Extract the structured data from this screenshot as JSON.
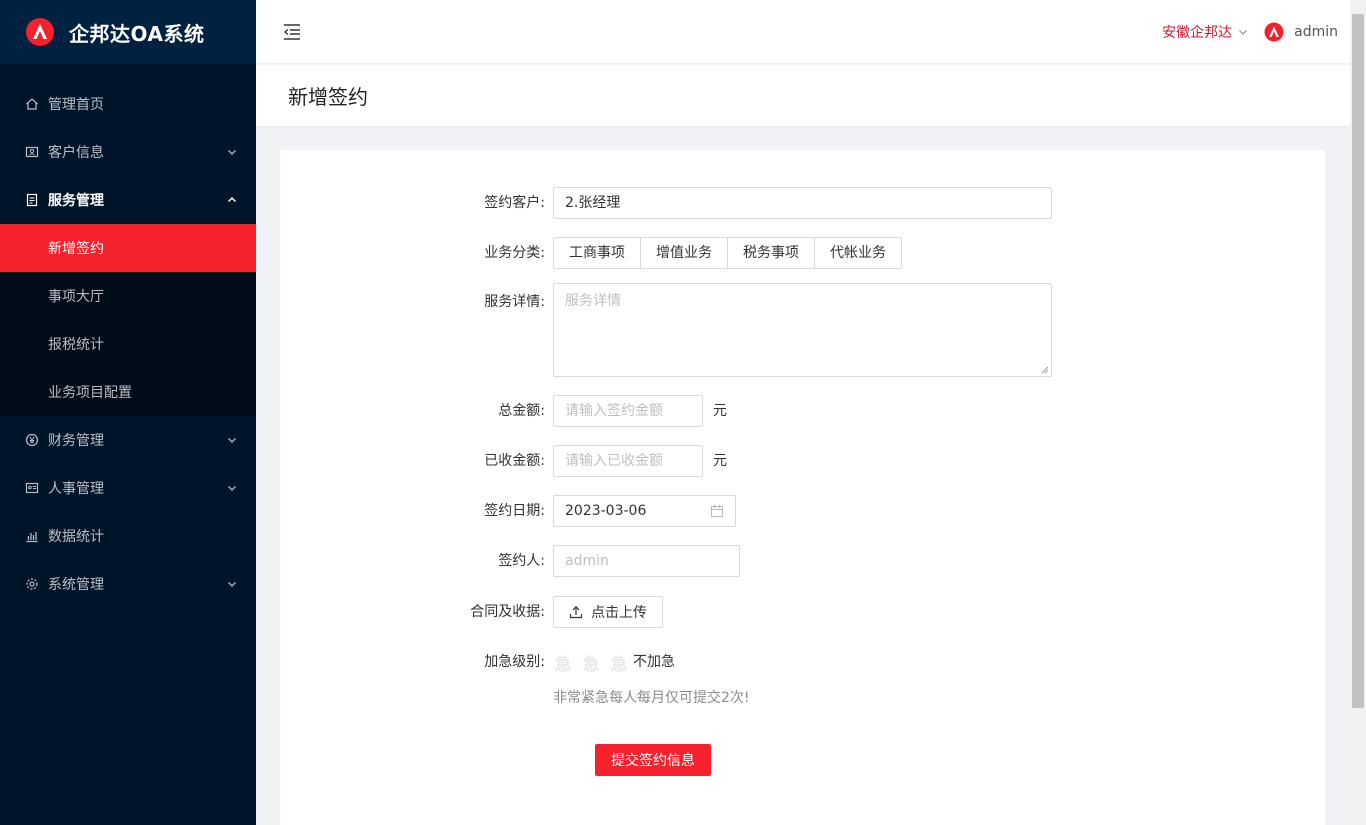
{
  "brand": {
    "title": "企邦达OA系统",
    "logo_icon": "logo-icon",
    "accent": "#f5222d"
  },
  "sidebar": {
    "items": [
      {
        "label": "管理首页",
        "icon": "home-icon"
      },
      {
        "label": "客户信息",
        "icon": "customer-card-icon"
      },
      {
        "label": "服务管理",
        "icon": "service-doc-icon"
      },
      {
        "label": "财务管理",
        "icon": "yen-icon"
      },
      {
        "label": "人事管理",
        "icon": "id-card-icon"
      },
      {
        "label": "数据统计",
        "icon": "bar-chart-icon"
      },
      {
        "label": "系统管理",
        "icon": "gear-icon"
      }
    ],
    "submenu": [
      {
        "label": "新增签约",
        "active": true
      },
      {
        "label": "事项大厅"
      },
      {
        "label": "报税统计"
      },
      {
        "label": "业务项目配置"
      }
    ]
  },
  "header": {
    "company": "安徽企邦达",
    "username": "admin"
  },
  "page": {
    "title": "新增签约"
  },
  "form": {
    "customer": {
      "label": "签约客户:",
      "value": "2.张经理"
    },
    "category": {
      "label": "业务分类:",
      "options": [
        "工商事项",
        "增值业务",
        "税务事项",
        "代帐业务"
      ]
    },
    "detail": {
      "label": "服务详情:",
      "placeholder": "服务详情"
    },
    "total": {
      "label": "总金额:",
      "placeholder": "请输入签约金额",
      "unit": "元"
    },
    "received": {
      "label": "已收金额:",
      "placeholder": "请输入已收金额",
      "unit": "元"
    },
    "date": {
      "label": "签约日期:",
      "value": "2023-03-06"
    },
    "signer": {
      "label": "签约人:",
      "placeholder": "admin"
    },
    "contract": {
      "label": "合同及收据:",
      "button": "点击上传"
    },
    "urgency": {
      "label": "加急级别:",
      "star_char": "急",
      "value_text": "不加急",
      "hint": "非常紧急每人每月仅可提交2次!"
    },
    "submit": "提交签约信息"
  }
}
